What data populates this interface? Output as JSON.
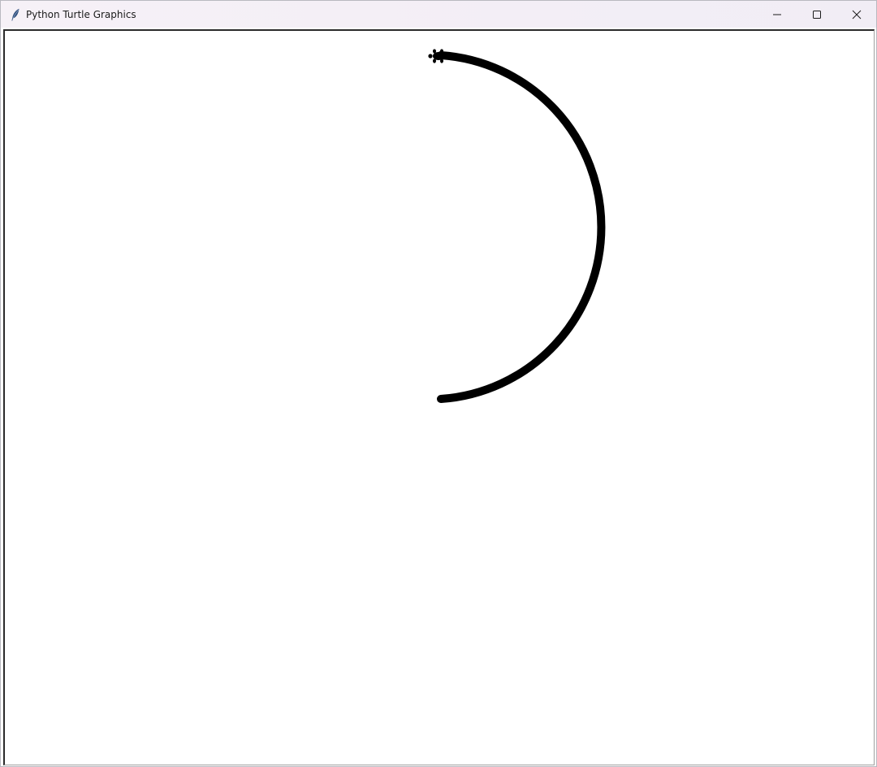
{
  "window": {
    "title": "Python Turtle Graphics",
    "icon": "feather-icon",
    "controls": {
      "minimize": "minimize-icon",
      "maximize": "maximize-icon",
      "close": "close-icon"
    }
  },
  "canvas": {
    "background": "#ffffff",
    "pen_color": "#000000",
    "drawing": "semicircle-arc",
    "turtle_shape": "turtle-icon"
  }
}
